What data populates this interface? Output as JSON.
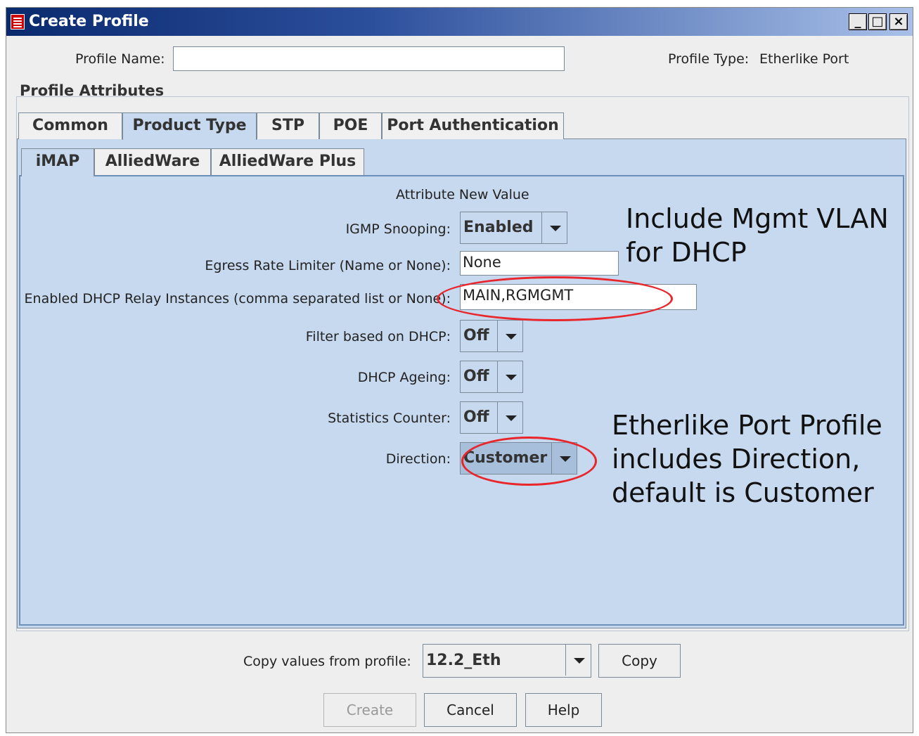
{
  "window": {
    "title": "Create Profile",
    "controls": {
      "minimize": "_",
      "maximize": "□",
      "close": "×"
    }
  },
  "header": {
    "profile_name_label": "Profile Name:",
    "profile_name_value": "",
    "profile_type_label": "Profile Type:",
    "profile_type_value": "Etherlike Port"
  },
  "group": {
    "title": "Profile Attributes"
  },
  "tabs": [
    {
      "label": "Common",
      "selected": false
    },
    {
      "label": "Product Type",
      "selected": true
    },
    {
      "label": "STP",
      "selected": false
    },
    {
      "label": "POE",
      "selected": false
    },
    {
      "label": "Port Authentication",
      "selected": false
    }
  ],
  "subtabs": [
    {
      "label": "iMAP",
      "selected": true
    },
    {
      "label": "AlliedWare",
      "selected": false
    },
    {
      "label": "AlliedWare Plus",
      "selected": false
    }
  ],
  "attributes": {
    "column_header": "Attribute New Value",
    "igmp": {
      "label": "IGMP Snooping:",
      "value": "Enabled"
    },
    "egress": {
      "label": "Egress Rate Limiter (Name or None):",
      "value": "None"
    },
    "dhcp_relay": {
      "label": "Enabled DHCP Relay Instances (comma separated list or None):",
      "value": "MAIN,RGMGMT"
    },
    "filter_dhcp": {
      "label": "Filter based on DHCP:",
      "value": "Off"
    },
    "dhcp_ageing": {
      "label": "DHCP Ageing:",
      "value": "Off"
    },
    "stats_counter": {
      "label": "Statistics Counter:",
      "value": "Off"
    },
    "direction": {
      "label": "Direction:",
      "value": "Customer"
    }
  },
  "annotations": {
    "mgmt_vlan": [
      "Include Mgmt VLAN",
      "for DHCP"
    ],
    "direction_note": [
      "Etherlike Port Profile",
      "includes Direction,",
      "default is Customer"
    ],
    "highlight_color": "#e8262b"
  },
  "footer": {
    "copy_label": "Copy values from profile:",
    "copy_profile_value": "12.2_Eth",
    "copy_button": "Copy",
    "create_button": "Create",
    "cancel_button": "Cancel",
    "help_button": "Help"
  }
}
